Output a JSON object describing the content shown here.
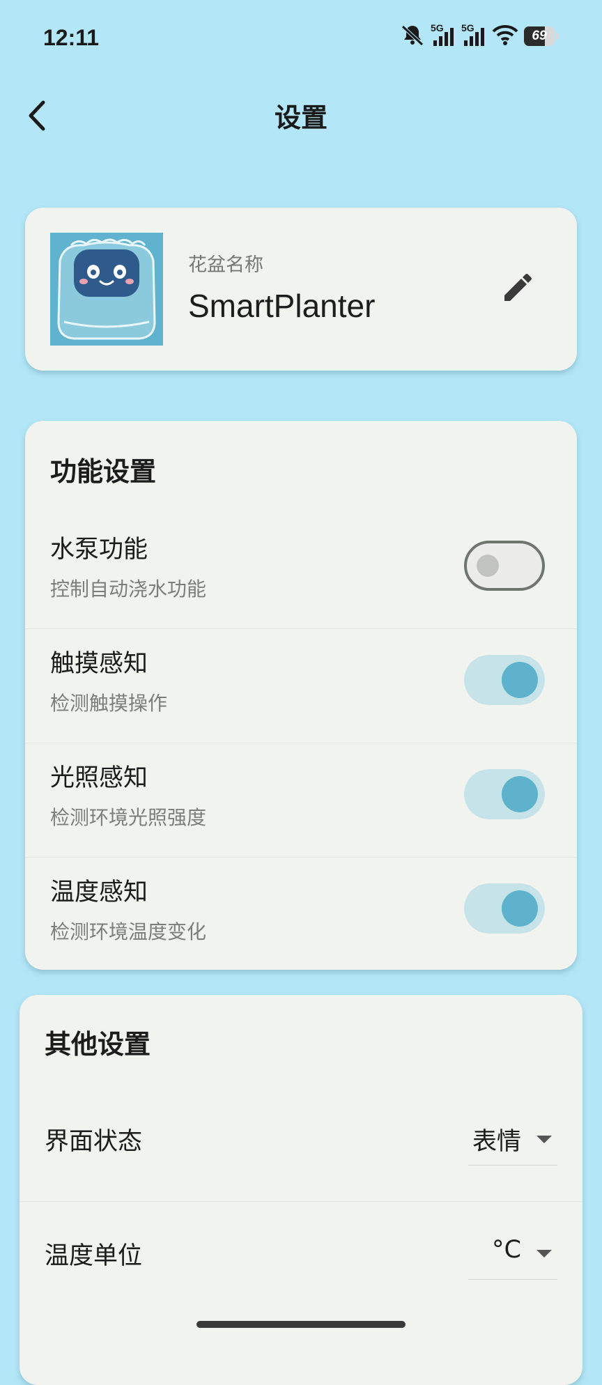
{
  "status_bar": {
    "time": "12:11",
    "network_1": "5G",
    "network_2": "5G",
    "battery": "69",
    "battery_level": 0.69
  },
  "app_bar": {
    "title": "设置"
  },
  "planter": {
    "name_label": "花盆名称",
    "name_value": "SmartPlanter"
  },
  "function_settings": {
    "title": "功能设置",
    "items": [
      {
        "title": "水泵功能",
        "desc": "控制自动浇水功能",
        "enabled": false
      },
      {
        "title": "触摸感知",
        "desc": "检测触摸操作",
        "enabled": true
      },
      {
        "title": "光照感知",
        "desc": "检测环境光照强度",
        "enabled": true
      },
      {
        "title": "温度感知",
        "desc": "检测环境温度变化",
        "enabled": true
      }
    ]
  },
  "other_settings": {
    "title": "其他设置",
    "items": [
      {
        "label": "界面状态",
        "value": "表情"
      },
      {
        "label": "温度单位",
        "value": "°C"
      }
    ]
  },
  "colors": {
    "background": "#b3e6f7",
    "card": "#f1f4ee",
    "accent": "#5eb2cb",
    "switch_track_on": "#c6e3ea"
  }
}
